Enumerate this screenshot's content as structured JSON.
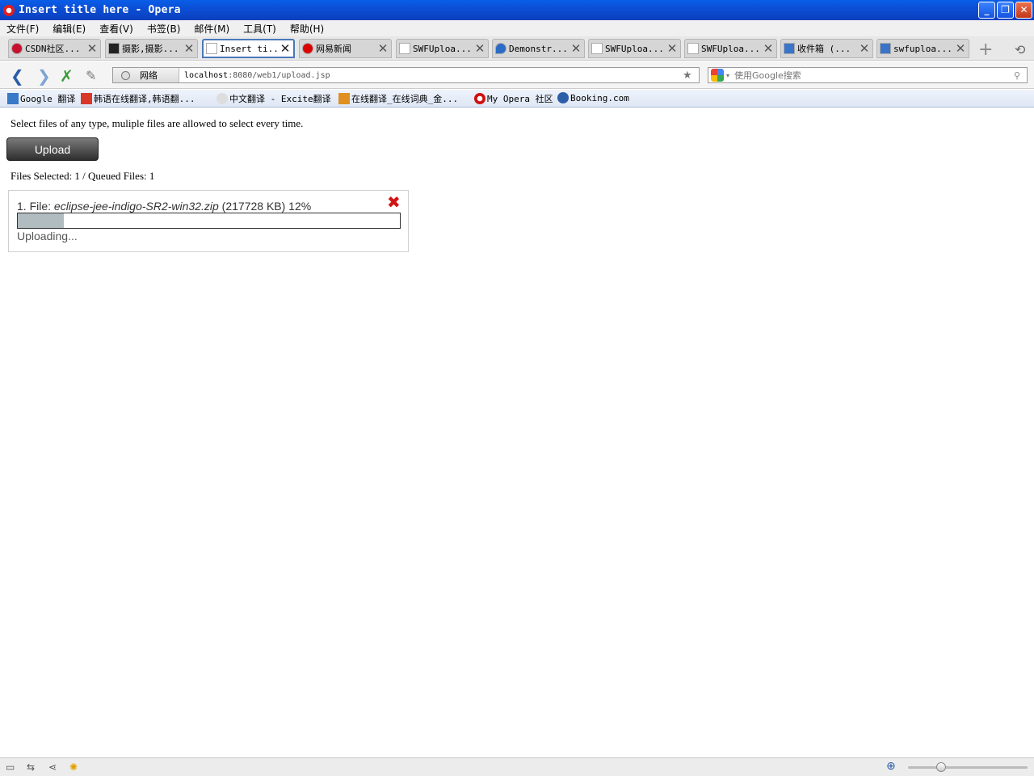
{
  "window": {
    "title": "Insert title here - Opera",
    "min": "_",
    "max": "❐",
    "close": "✕"
  },
  "menu": [
    "文件(F)",
    "编辑(E)",
    "查看(V)",
    "书签(B)",
    "邮件(M)",
    "工具(T)",
    "帮助(H)"
  ],
  "tabs": [
    {
      "label": "CSDN社区...",
      "icon_color": "#c8102e"
    },
    {
      "label": "摄影,摄影...",
      "icon_color": "#b22"
    },
    {
      "label": "Insert ti...",
      "icon_color": "#d33",
      "active": true
    },
    {
      "label": "网易新闻",
      "icon_color": "#d00"
    },
    {
      "label": "SWFUploa...",
      "icon_color": "#fff"
    },
    {
      "label": "Demonstr...",
      "icon_color": "#2a6bc5"
    },
    {
      "label": "SWFUploa...",
      "icon_color": "#fff"
    },
    {
      "label": "SWFUploa...",
      "icon_color": "#fff"
    },
    {
      "label": "收件箱 (...",
      "icon_color": "#3a74c8"
    },
    {
      "label": "swfuploa...",
      "icon_color": "#3a74c8"
    }
  ],
  "tab_close": "✕",
  "new_tab": "+",
  "trash": "⟲",
  "nav": {
    "back": "❮",
    "forward": "❯",
    "reload": "✗",
    "edit": "✎"
  },
  "address": {
    "network_label": "网络",
    "host": "localhost",
    "path": ":8080/web1/upload.jsp",
    "star": "★"
  },
  "search": {
    "placeholder": "使用Google搜索",
    "go": "⚲",
    "drop": "▾"
  },
  "bookmarks": [
    {
      "label": "Google 翻译",
      "color": "#3a78c8"
    },
    {
      "label": "韩语在线翻译,韩语翻...",
      "color": "#d8382a"
    },
    {
      "label": "中文翻译 - Excite翻译",
      "color": "#999"
    },
    {
      "label": "在线翻译_在线词典_金...",
      "color": "#e09020"
    },
    {
      "label": "My Opera 社区",
      "color": "#d01010"
    },
    {
      "label": "Booking.com",
      "color": "#2c5fa8"
    }
  ],
  "page": {
    "instruction": "Select files of any type, muliple files are allowed to select every time.",
    "upload_label": "Upload",
    "stats": "Files Selected: 1 / Queued Files: 1",
    "file": {
      "prefix": "1.  File: ",
      "name": "eclipse-jee-indigo-SR2-win32.zip",
      "suffix": " (217728 KB) 12%",
      "progress": 0.12,
      "status": "Uploading...",
      "cancel": "✖"
    }
  },
  "statusbar": {
    "panel": "▭",
    "sync": "⇆",
    "share": "⋖",
    "unite": "✺",
    "zoom_icon": "⊕",
    "zoom_level": 0.28
  }
}
